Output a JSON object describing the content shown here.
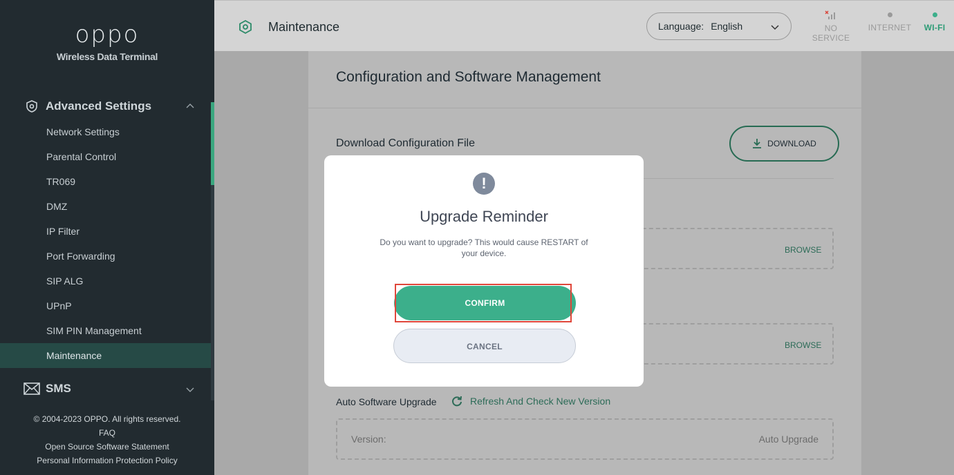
{
  "brand": {
    "logo": "oppo",
    "subtitle": "Wireless Data Terminal"
  },
  "sidebar": {
    "group_label": "Advanced Settings",
    "items": [
      {
        "label": "Network Settings",
        "active": false
      },
      {
        "label": "Parental Control",
        "active": false
      },
      {
        "label": "TR069",
        "active": false
      },
      {
        "label": "DMZ",
        "active": false
      },
      {
        "label": "IP Filter",
        "active": false
      },
      {
        "label": "Port Forwarding",
        "active": false
      },
      {
        "label": "SIP ALG",
        "active": false
      },
      {
        "label": "UPnP",
        "active": false
      },
      {
        "label": "SIM PIN Management",
        "active": false
      },
      {
        "label": "Maintenance",
        "active": true
      }
    ],
    "sms_label": "SMS"
  },
  "footer": {
    "copyright": "© 2004-2023 OPPO. All rights reserved.",
    "faq": "FAQ",
    "open_source": "Open Source Software Statement",
    "privacy": "Personal Information Protection Policy"
  },
  "header": {
    "title": "Maintenance",
    "language_label": "Language:",
    "language_value": "English",
    "status": {
      "no_service": "NO SERVICE",
      "internet": "INTERNET",
      "wifi": "WI-FI"
    }
  },
  "colors": {
    "accent": "#3caf8b",
    "sidebar_bg": "#222b30",
    "active_item": "#264a46",
    "alert_red": "#e0463a"
  },
  "main": {
    "card_title": "Configuration and Software Management",
    "download_config_label": "Download Configuration File",
    "download_button": "DOWNLOAD",
    "browse_1": "BROWSE",
    "browse_2": "BROWSE",
    "auto_upgrade_label": "Auto Software Upgrade",
    "refresh_label": "Refresh And Check New Version",
    "version_label": "Version:",
    "auto_upgrade_value": "Auto Upgrade"
  },
  "modal": {
    "icon": "exclamation-icon",
    "icon_glyph": "!",
    "title": "Upgrade Reminder",
    "message": "Do you want to upgrade? This would cause RESTART of your device.",
    "confirm": "CONFIRM",
    "cancel": "CANCEL"
  }
}
